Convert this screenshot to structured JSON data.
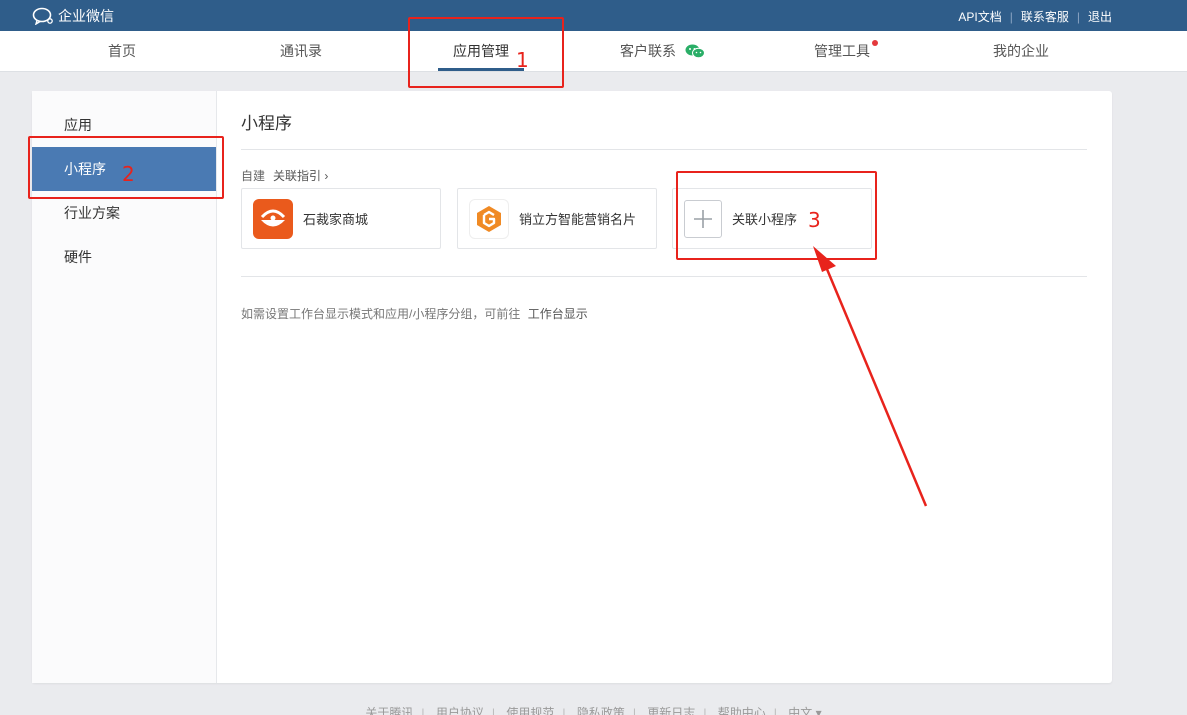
{
  "topbar": {
    "brand": "企业微信",
    "links": [
      "API文档",
      "联系客服",
      "退出"
    ]
  },
  "nav": {
    "items": [
      "首页",
      "通讯录",
      "应用管理",
      "客户联系",
      "管理工具",
      "我的企业"
    ],
    "active": "应用管理"
  },
  "sidebar": {
    "items": [
      "应用",
      "小程序",
      "行业方案",
      "硬件"
    ],
    "active": "小程序"
  },
  "content": {
    "title": "小程序",
    "self_built": "自建",
    "guide_link": "关联指引",
    "apps": [
      {
        "name": "石裁家商城",
        "color": "#ea5a1c"
      },
      {
        "name": "销立方智能营销名片",
        "color": "#f08a24"
      }
    ],
    "add_label": "关联小程序",
    "hint_text": "如需设置工作台显示模式和应用/小程序分组，可前往",
    "hint_link": "工作台显示"
  },
  "annotations": {
    "labels": [
      "1",
      "2",
      "3"
    ],
    "color": "#e8231c"
  },
  "footer": {
    "links": [
      "关于腾讯",
      "用户协议",
      "使用规范",
      "隐私政策",
      "更新日志",
      "帮助中心",
      "中文 ▾"
    ]
  },
  "colors": {
    "topbar": "#2f5d8a",
    "sidebar_active": "#4a7ab3"
  }
}
